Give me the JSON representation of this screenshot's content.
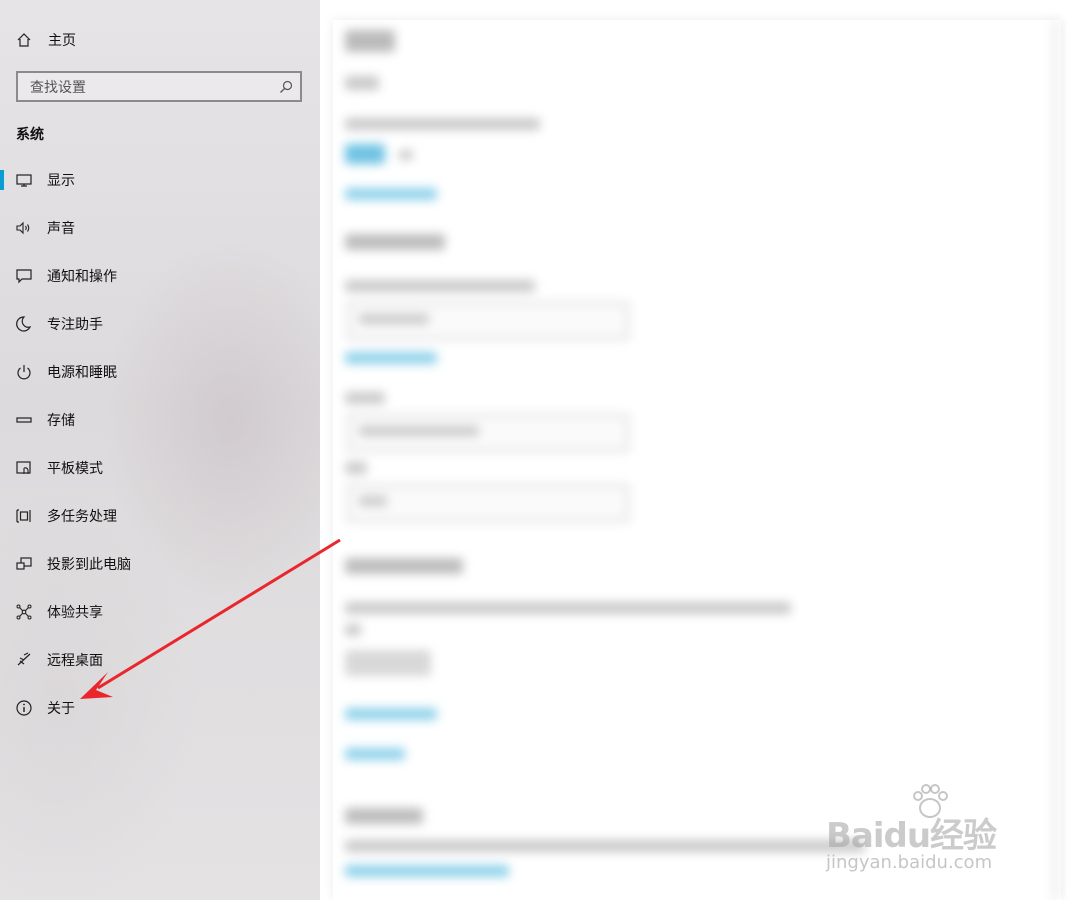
{
  "sidebar": {
    "home_label": "主页",
    "search_placeholder": "查找设置",
    "section_title": "系统",
    "accent_color": "#0a9ed0",
    "items": [
      {
        "label": "显示",
        "icon": "monitor-icon",
        "active": true
      },
      {
        "label": "声音",
        "icon": "speaker-icon"
      },
      {
        "label": "通知和操作",
        "icon": "message-icon"
      },
      {
        "label": "专注助手",
        "icon": "moon-icon"
      },
      {
        "label": "电源和睡眠",
        "icon": "power-icon"
      },
      {
        "label": "存储",
        "icon": "storage-icon"
      },
      {
        "label": "平板模式",
        "icon": "tablet-icon"
      },
      {
        "label": "多任务处理",
        "icon": "multitask-icon"
      },
      {
        "label": "投影到此电脑",
        "icon": "project-icon"
      },
      {
        "label": "体验共享",
        "icon": "share-icon"
      },
      {
        "label": "远程桌面",
        "icon": "remote-icon"
      },
      {
        "label": "关于",
        "icon": "info-icon"
      }
    ]
  },
  "annotation": {
    "arrow_color": "#e8262b",
    "target": "关于"
  },
  "watermark": {
    "logo": "Baidu经验",
    "url": "jingyan.baidu.com"
  }
}
